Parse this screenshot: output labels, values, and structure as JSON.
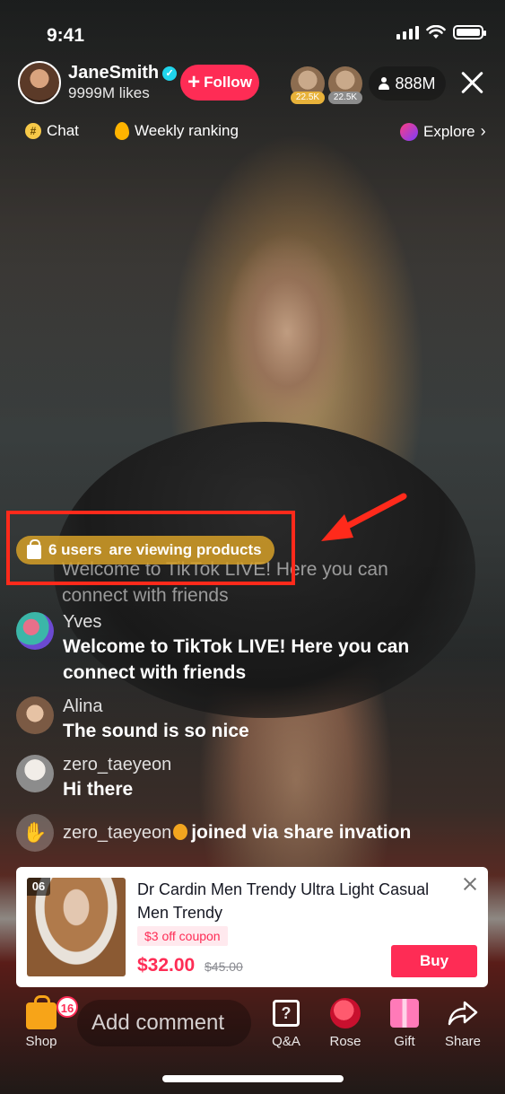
{
  "status_bar": {
    "time": "9:41"
  },
  "host": {
    "name": "JaneSmith",
    "likes": "9999M likes",
    "follow_label": "Follow"
  },
  "top_viewers": [
    {
      "gift_count": "22.5K"
    },
    {
      "gift_count": "22.5K"
    }
  ],
  "viewer_count": "888M",
  "subnav": {
    "chat": "Chat",
    "ranking": "Weekly ranking",
    "explore": "Explore"
  },
  "viewing_banner": {
    "count_text": "6 users",
    "suffix_text": "are viewing products"
  },
  "faded_comment": {
    "line1": "Welcome to TikTok LIVE! Here you can",
    "line2": "connect with friends"
  },
  "comments": [
    {
      "user": "Yves",
      "text_line1": "Welcome to TikTok LIVE! Here you can",
      "text_line2": "connect with friends"
    },
    {
      "user": "Alina",
      "text_line1": "The sound is so nice"
    },
    {
      "user": "zero_taeyeon",
      "text_line1": "Hi there"
    }
  ],
  "join_event": {
    "user": "zero_taeyeon",
    "text": "joined via share invation"
  },
  "product": {
    "index": "06",
    "title": "Dr Cardin Men Trendy Ultra Light Casual Men Trendy",
    "coupon": "$3 off coupon",
    "price": "$32.00",
    "original_price": "$45.00",
    "buy_label": "Buy"
  },
  "bottom_bar": {
    "shop_label": "Shop",
    "shop_badge": "16",
    "comment_placeholder": "Add comment",
    "qa_label": "Q&A",
    "rose_label": "Rose",
    "gift_label": "Gift",
    "share_label": "Share"
  },
  "colors": {
    "accent": "#fe2c55",
    "annotation": "#ff2a1b",
    "banner": "#d6a028"
  }
}
